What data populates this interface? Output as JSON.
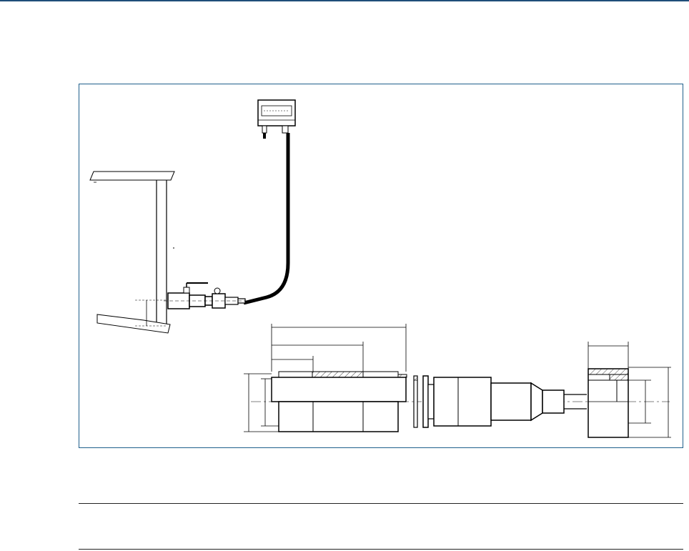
{
  "page": {
    "accent_color": "#1f4e79",
    "frame_color": "#1f5f8b"
  },
  "figure": {
    "components": [
      "transmitter-housing",
      "flexible-cable",
      "probe-assembly",
      "ball-valve",
      "pipe-wall",
      "ground-plate"
    ],
    "detail_components": [
      "probe-body",
      "retaining-rings",
      "nozzle-section",
      "end-cap"
    ]
  },
  "table": {
    "rows": []
  }
}
